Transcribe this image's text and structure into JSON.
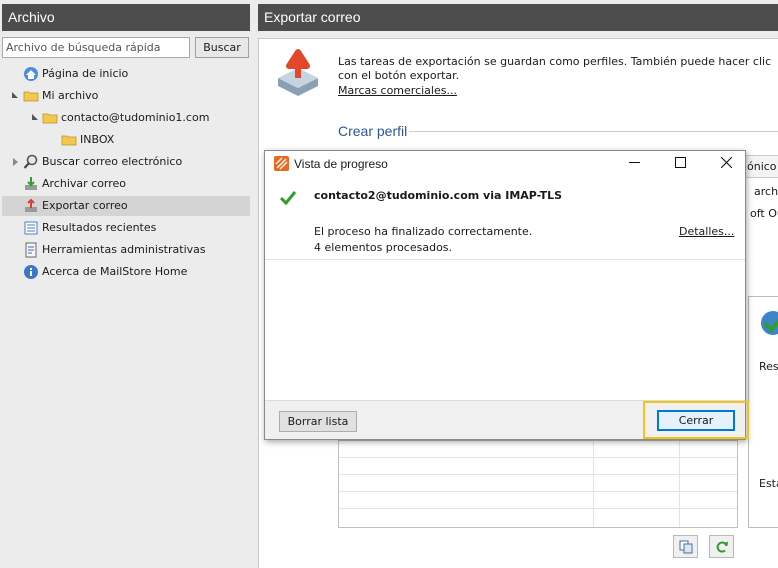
{
  "sidebar": {
    "title": "Archivo",
    "search_placeholder": "Archivo de búsqueda rápida",
    "search_button": "Buscar",
    "items": [
      {
        "label": "Página de inicio"
      },
      {
        "label": "Mi archivo"
      },
      {
        "label": "contacto@tudominio1.com"
      },
      {
        "label": "INBOX"
      },
      {
        "label": "Buscar correo electrónico"
      },
      {
        "label": "Archivar correo"
      },
      {
        "label": "Exportar correo",
        "selected": true
      },
      {
        "label": "Resultados recientes"
      },
      {
        "label": "Herramientas administrativas"
      },
      {
        "label": "Acerca de MailStore Home"
      }
    ]
  },
  "main": {
    "title": "Exportar correo",
    "info_text": "Las tareas de exportación se guardan como perfiles. También puede hacer clic con el botón exportar.",
    "trademark_link": "Marcas comerciales...",
    "section_title": "Crear perfil",
    "peek": {
      "tab_label": "ónico",
      "line1": "archiv",
      "line2": "oft Ou",
      "res_label": "Res",
      "est_label": "Esta"
    }
  },
  "dialog": {
    "title": "Vista de progreso",
    "account": "contacto2@tudominio.com via IMAP-TLS",
    "result": "El proceso ha finalizado correctamente.",
    "count": "4 elementos procesados.",
    "details_link": "Detalles...",
    "clear_button": "Borrar lista",
    "close_button": "Cerrar"
  },
  "colors": {
    "header_bg": "#4d4d4d",
    "accent_blue": "#2b5797",
    "highlight_border": "#f2c31a",
    "success_green": "#2e9e2e"
  }
}
